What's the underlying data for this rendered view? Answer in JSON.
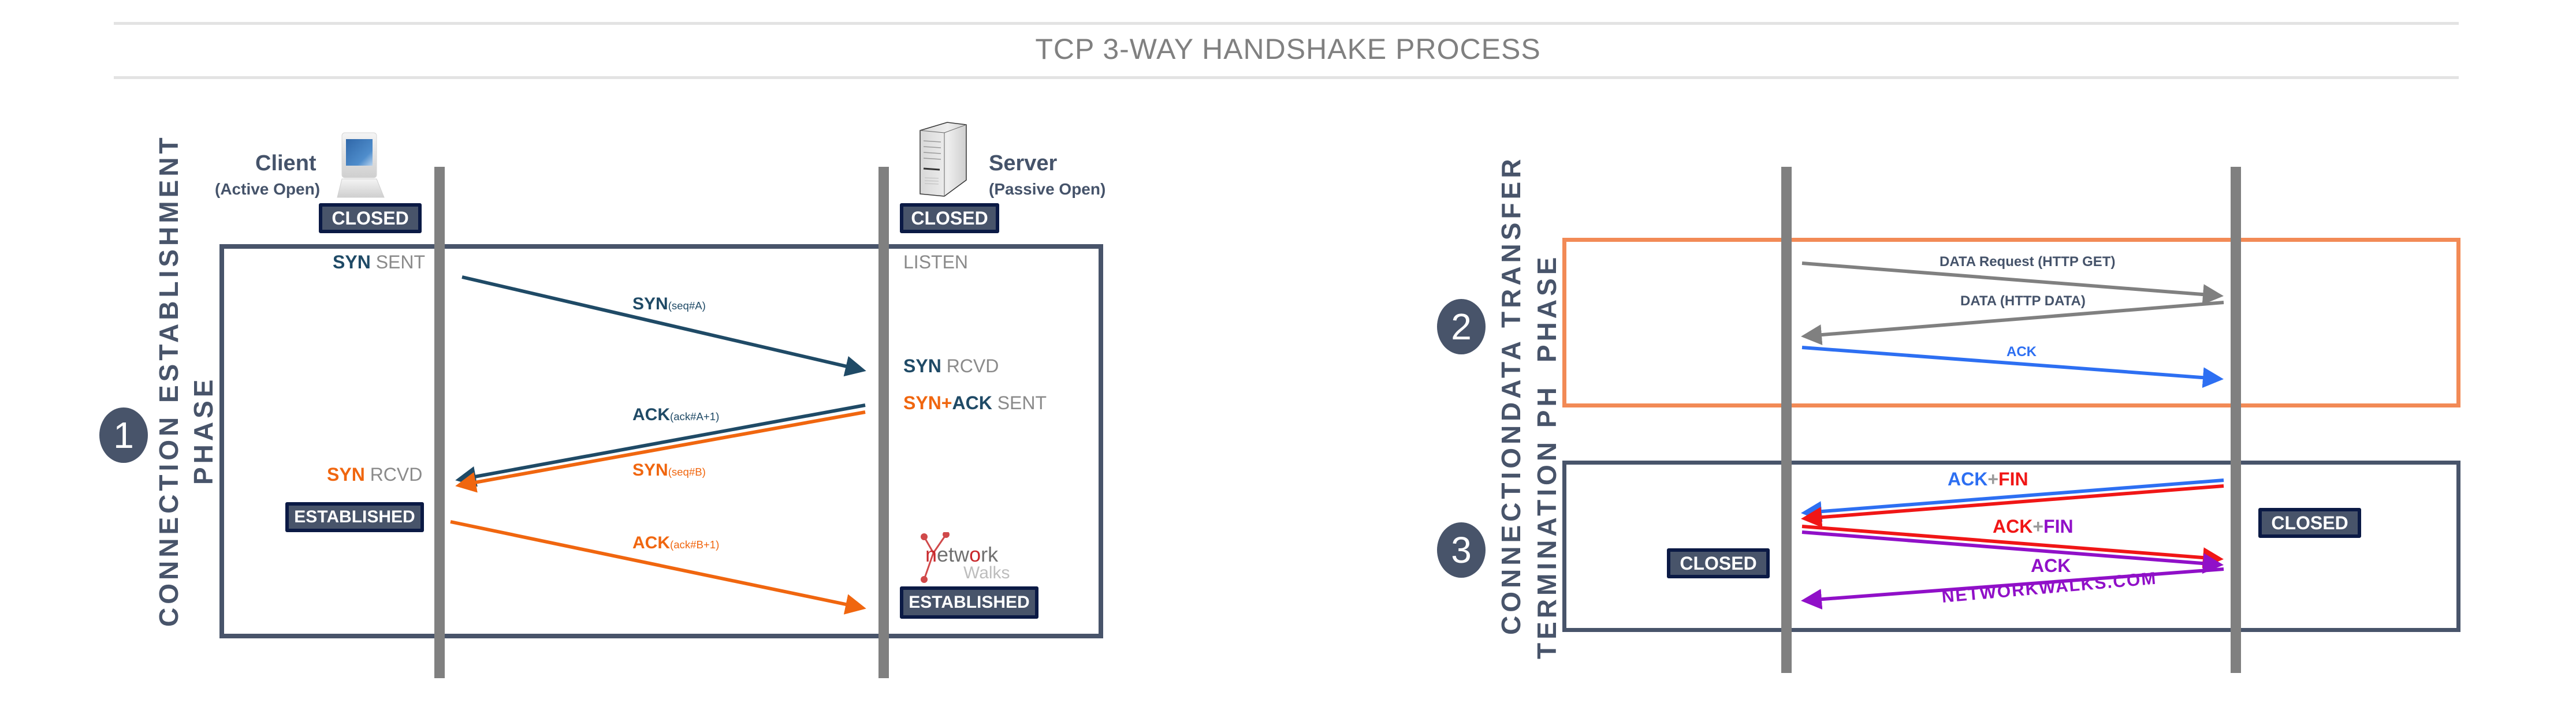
{
  "header": {
    "title": "TCP 3-WAY HANDSHAKE PROCESS"
  },
  "hosts": {
    "client": {
      "name": "Client",
      "mode": "(Active Open)",
      "icon": "computer-icon",
      "initial_state": "CLOSED"
    },
    "server": {
      "name": "Server",
      "mode": "(Passive Open)",
      "icon": "server-icon",
      "initial_state": "CLOSED"
    }
  },
  "phases": [
    {
      "number": "1",
      "label_line1": "CONNECTION ESTABLISHMENT",
      "label_line2": "PHASE",
      "border_color": "#48546a"
    },
    {
      "number": "2",
      "label_line1": "DATA TRANSFER",
      "label_line2": "PHASE",
      "border_color": "#f28a56"
    },
    {
      "number": "3",
      "label_line1": "CONNECTION",
      "label_line2": "TERMINATION PH",
      "border_color": "#48546a"
    }
  ],
  "establishment": {
    "client_states": {
      "syn_sent": {
        "flag": "SYN",
        "state": "SENT"
      },
      "syn_rcvd": {
        "flag": "SYN",
        "state": "RCVD"
      },
      "established": "ESTABLISHED"
    },
    "server_states": {
      "listen": "LISTEN",
      "syn_rcvd": {
        "flag": "SYN",
        "state": "RCVD"
      },
      "synack_sent": {
        "flag1": "SYN",
        "plus": "+",
        "flag2": "ACK",
        "state": "SENT"
      },
      "established": "ESTABLISHED"
    },
    "messages": [
      {
        "flag": "SYN",
        "detail": "(seq#A)",
        "direction": "client-to-server",
        "color": "#1f4a66"
      },
      {
        "flag": "ACK",
        "detail": "(ack#A+1)",
        "direction": "server-to-client",
        "color": "#1f4a66"
      },
      {
        "flag": "SYN",
        "detail": "(seq#B)",
        "direction": "server-to-client",
        "color": "#f0660f"
      },
      {
        "flag": "ACK",
        "detail": "(ack#B+1)",
        "direction": "client-to-server",
        "color": "#f0660f"
      }
    ]
  },
  "data_transfer": {
    "messages": [
      {
        "label": "DATA Request (HTTP GET)",
        "direction": "client-to-server",
        "color": "#808080"
      },
      {
        "label": "DATA (HTTP DATA)",
        "direction": "server-to-client",
        "color": "#808080"
      },
      {
        "label": "ACK",
        "direction": "client-to-server",
        "color": "#2d6ff2"
      }
    ]
  },
  "termination": {
    "messages": [
      {
        "part1": "ACK",
        "plus": "+",
        "part2": "FIN",
        "direction": "server-to-client",
        "colors": [
          "#2d6ff2",
          "#f01616"
        ]
      },
      {
        "part1": "ACK",
        "plus": "+",
        "part2": "FIN",
        "direction": "client-to-server",
        "colors": [
          "#f01616",
          "#9010c8"
        ]
      },
      {
        "label": "ACK",
        "direction": "server-to-client",
        "color": "#9010c8"
      }
    ],
    "client_state": "CLOSED",
    "server_state": "CLOSED",
    "watermark": "NETWORKWALKS.COM"
  },
  "logo": {
    "part1": "n",
    "part2": "etw",
    "part3": "o",
    "part4": "rk",
    "part5": "Walks"
  }
}
